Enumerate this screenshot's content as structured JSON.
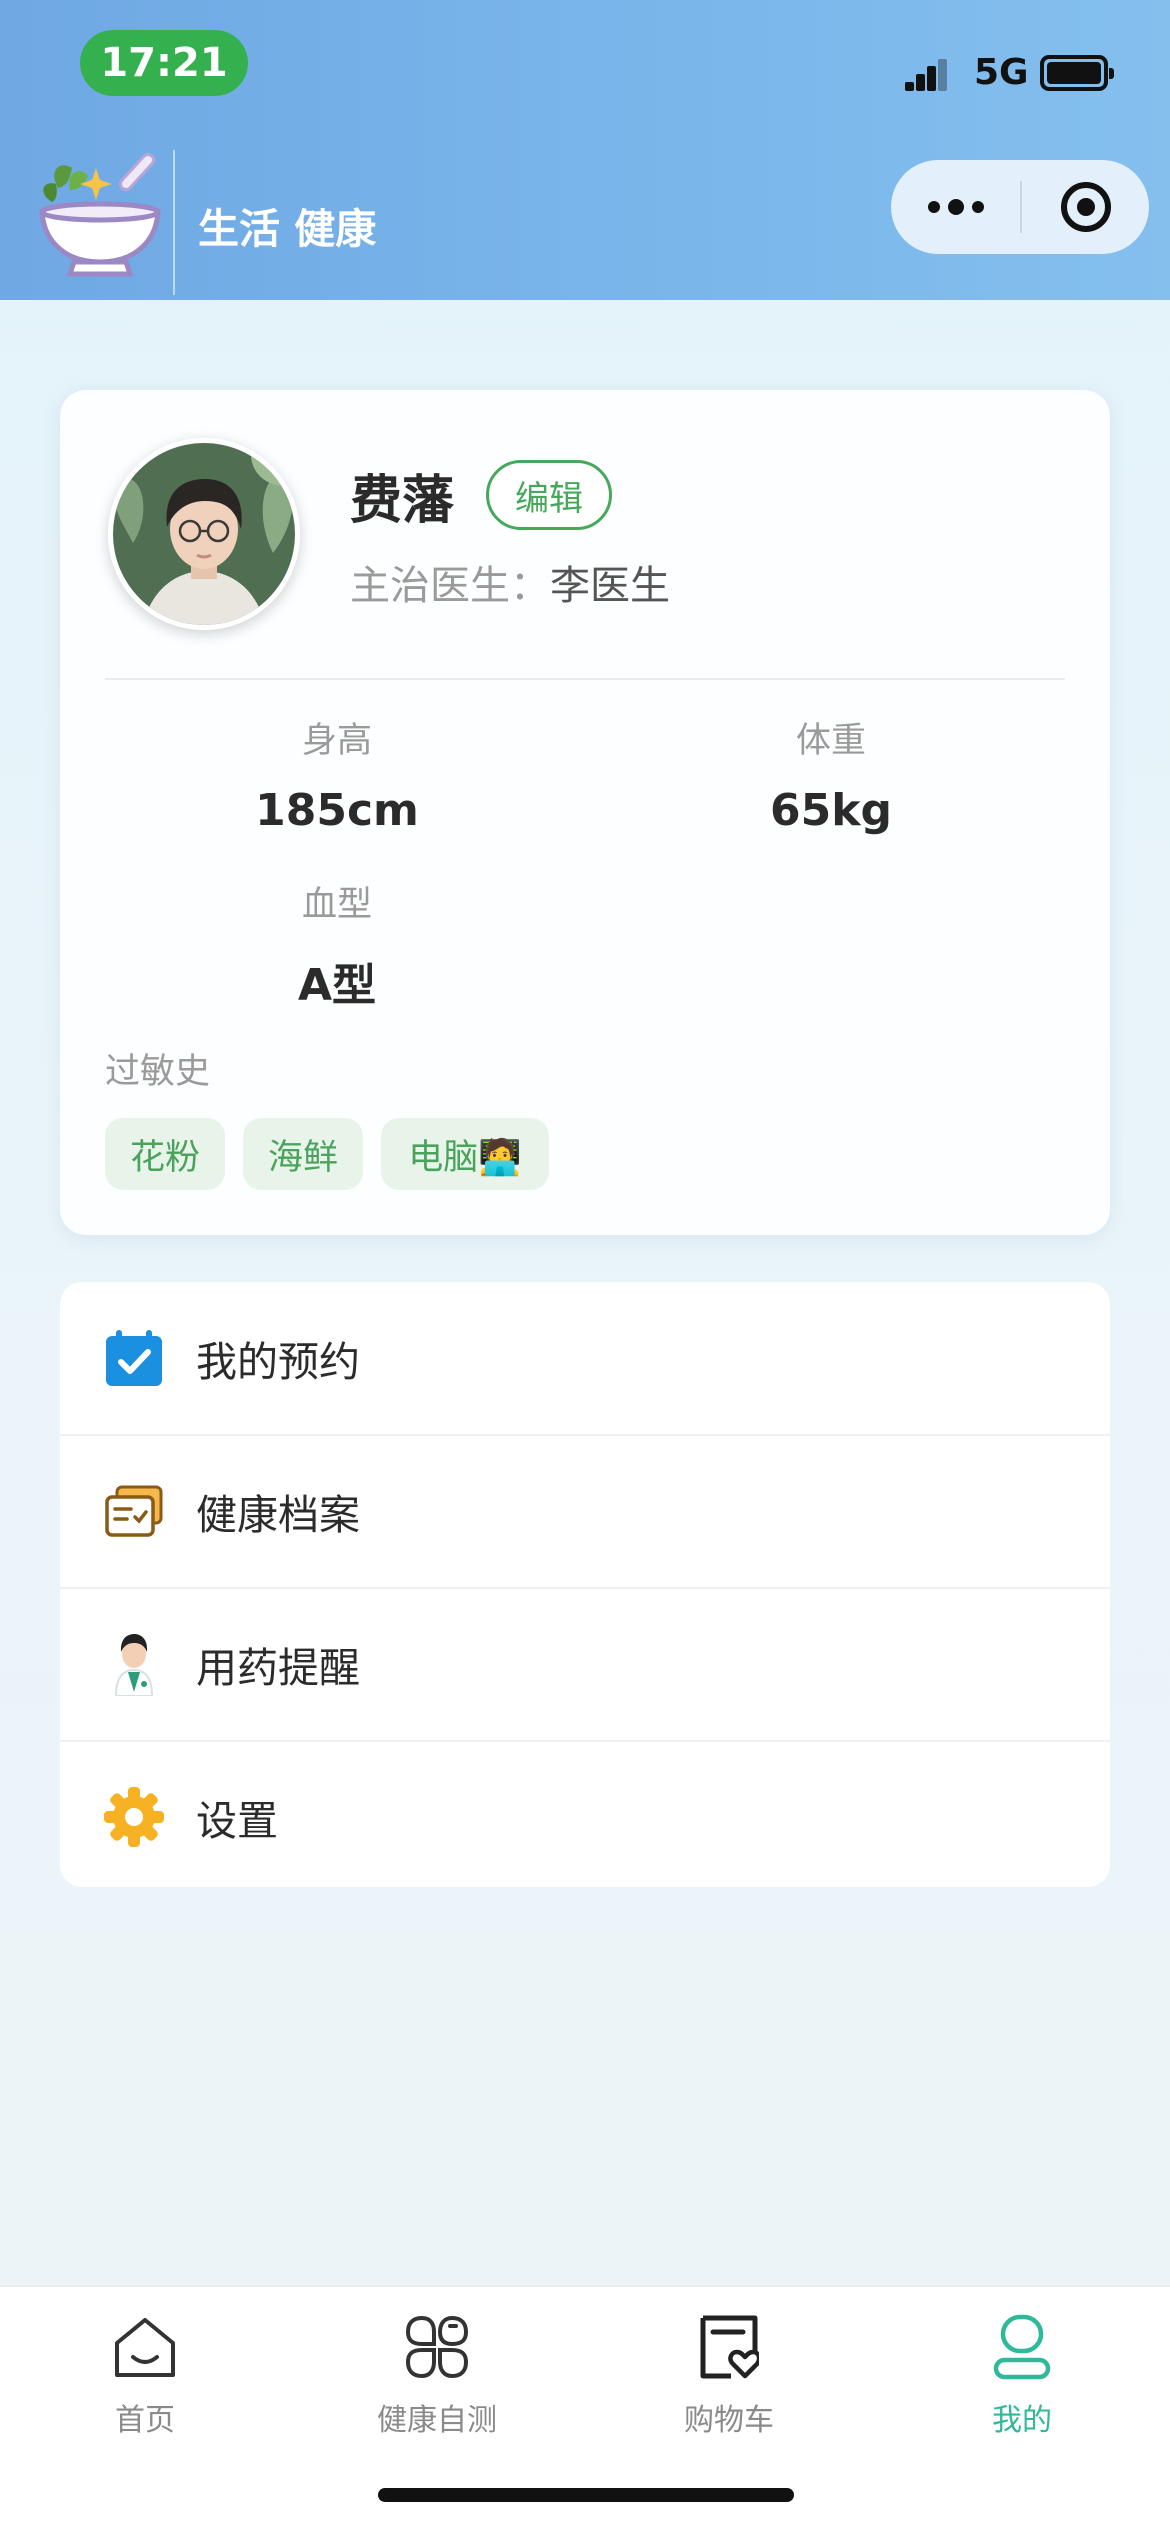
{
  "status_bar": {
    "time": "17:21",
    "network": "5G"
  },
  "header": {
    "title": "生活 健康",
    "capsule": {
      "more_icon": "ellipsis-icon",
      "close_icon": "target-close-icon"
    }
  },
  "profile": {
    "name": "费藩",
    "edit_label": "编辑",
    "doctor_label": "主治医生：",
    "doctor_name": "李医生",
    "stats": [
      {
        "label": "身高",
        "value": "185cm"
      },
      {
        "label": "体重",
        "value": "65kg"
      },
      {
        "label": "血型",
        "value": "A型"
      }
    ],
    "allergy_label": "过敏史",
    "allergies": [
      "花粉",
      "海鲜",
      "电脑🧑‍💻"
    ]
  },
  "menu": [
    {
      "label": "我的预约",
      "icon": "calendar-check-icon",
      "color": "#1b8fe0"
    },
    {
      "label": "健康档案",
      "icon": "health-record-icon",
      "color": "#a8741a"
    },
    {
      "label": "用药提醒",
      "icon": "doctor-icon",
      "color": "#2a9d79"
    },
    {
      "label": "设置",
      "icon": "gear-icon",
      "color": "#f6b223"
    }
  ],
  "tabbar": [
    {
      "label": "首页",
      "icon": "home-icon"
    },
    {
      "label": "健康自测",
      "icon": "grid-icon"
    },
    {
      "label": "购物车",
      "icon": "cart-heart-icon"
    },
    {
      "label": "我的",
      "icon": "user-icon",
      "active": true
    }
  ],
  "colors": {
    "accent_green": "#46a85a",
    "tab_active": "#2fb99a",
    "header_blue": "#79b4ea"
  }
}
